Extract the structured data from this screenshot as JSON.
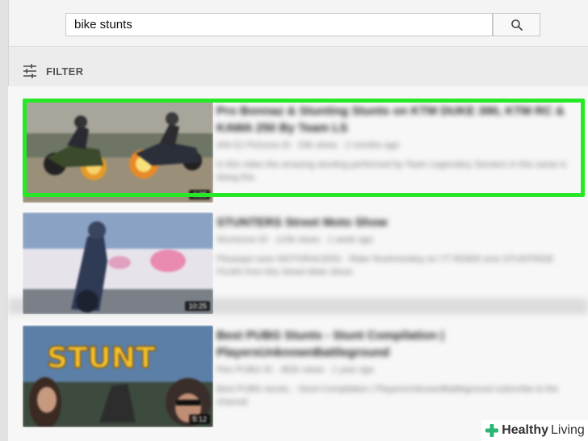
{
  "search": {
    "query": "bike stunts"
  },
  "filter": {
    "label": "FILTER"
  },
  "results": [
    {
      "title": "Pro Bonnaz & Stunting Stunts on KTM DUKE 390, KTM RC & KAWA 250 By Team LS",
      "channel": "ANI DJ Pictures ID · 93k views · 2 months ago",
      "description": "In this video the amazing stunting performed by Team Legendary Stunters in this saree is doing this",
      "duration": "4:35",
      "highlighted": true
    },
    {
      "title": "STUNTERS Street Moto Show",
      "channel": "Stuntzone ID · 123k views · 1 week ago",
      "description": "Pleasepo seen MOTORACERS · Rider Rushmonkey on YT RIDER emo STUNTRIDE FILMS from this Street Moto Show",
      "duration": "10:25",
      "highlighted": false
    },
    {
      "title": "Best PUBG Stunts - Stunt Compilation | PlayersUnknownBattleground",
      "channel": "Flex PUBG ID · 482k views · 1 year ago",
      "description": "Best PUBG stunts, - Stunt Compilation | PlayersUnknownBattleground subscribe to the channel",
      "duration": "5:12",
      "highlighted": false
    }
  ],
  "thumb_text": {
    "stunt": "STUNT"
  },
  "watermark": {
    "brand_bold": "Healthy",
    "brand_light": "Living"
  },
  "colors": {
    "highlight": "#27e827",
    "accent_watermark": "#2bb673"
  }
}
